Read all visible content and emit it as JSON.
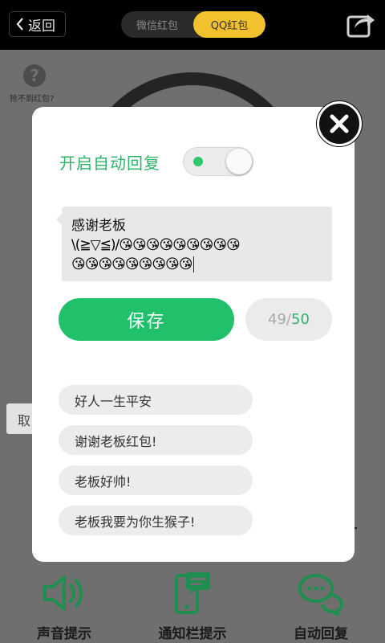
{
  "topbar": {
    "back_label": "返回",
    "tabs": [
      {
        "label": "微信红包",
        "active": false
      },
      {
        "label": "QQ红包",
        "active": true
      }
    ],
    "accent": "#f2c12e"
  },
  "background": {
    "help_text": "抢不到红包?",
    "cancel_label": "取"
  },
  "modal": {
    "auto_reply_label": "开启自动回复",
    "toggle_on": true,
    "message_line1": "感谢老板",
    "message_line2": "\\(≧▽≦)/😘😘😘😘😘😘😘😘😘",
    "message_line3": "😘😘😘😘😘😘😘😘😘",
    "save_label": "保存",
    "count_current": "49",
    "count_sep": "/",
    "count_max": "50",
    "presets": [
      "好人一生平安",
      "谢谢老板红包!",
      "老板好帅!",
      "老板我要为你生猴子!"
    ],
    "accent": "#21c06a"
  },
  "bottom_nav": [
    {
      "label": "声音提示",
      "icon": "speaker-icon"
    },
    {
      "label": "通知栏提示",
      "icon": "phone-notification-icon"
    },
    {
      "label": "自动回复",
      "icon": "chat-bubbles-icon"
    }
  ]
}
